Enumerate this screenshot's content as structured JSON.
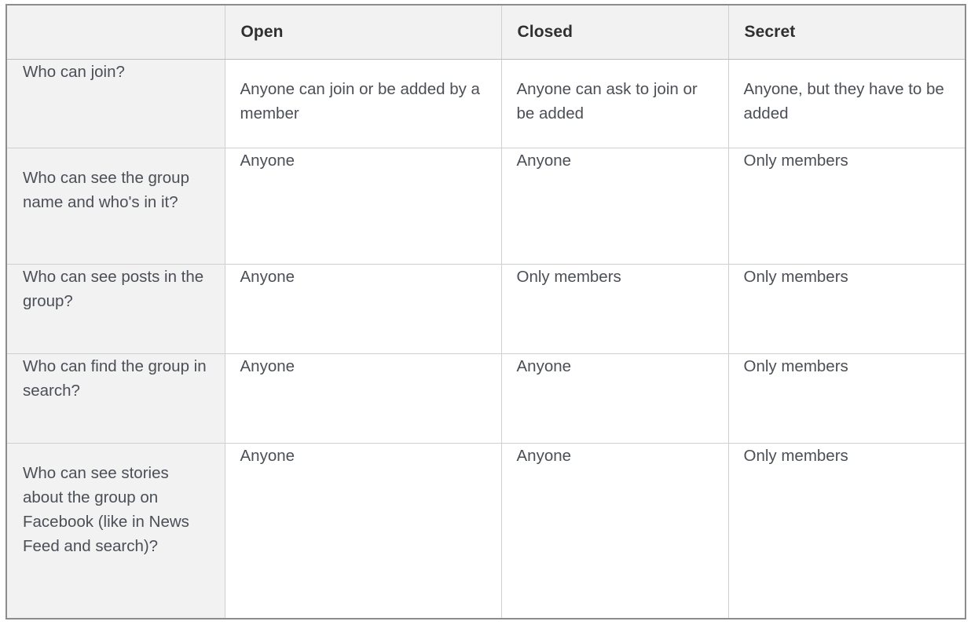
{
  "document": {
    "type": "comparison-table",
    "colors": {
      "outer_border": "#8c8c8c",
      "inner_grid": "#cfcfcf",
      "header_background": "#f2f2f2",
      "label_column_background": "#f2f2f2",
      "value_background": "#ffffff",
      "header_text": "#303030",
      "body_text": "#4b4f56",
      "page_background": "#ffffff"
    }
  },
  "table": {
    "columns": [
      {
        "key": "label",
        "label": ""
      },
      {
        "key": "open",
        "label": "Open"
      },
      {
        "key": "closed",
        "label": "Closed"
      },
      {
        "key": "secret",
        "label": "Secret"
      }
    ],
    "rows": [
      {
        "id": "who-can-join",
        "label": "Who can join?",
        "label_valign": "middle",
        "value_valign": "top",
        "open": "Anyone can join or be added by a member",
        "closed": "Anyone can ask to join or be added",
        "secret": "Anyone, but they have to be added"
      },
      {
        "id": "who-can-see-name",
        "label": "Who can see the group name and who's in it?",
        "label_valign": "top",
        "value_valign": "middle",
        "open": "Anyone",
        "closed": "Anyone",
        "secret": "Only members"
      },
      {
        "id": "who-can-see-posts",
        "label": "Who can see posts in the group?",
        "label_valign": "middle",
        "value_valign": "middle",
        "open": "Anyone",
        "closed": "Only members",
        "secret": "Only members"
      },
      {
        "id": "who-can-find-group",
        "label": "Who can find the group in search?",
        "label_valign": "middle",
        "value_valign": "middle",
        "open": "Anyone",
        "closed": "Anyone",
        "secret": "Only members"
      },
      {
        "id": "who-can-see-stories",
        "label": "Who can see stories about the group on Facebook (like in News Feed and search)?",
        "label_valign": "top",
        "value_valign": "middle",
        "open": "Anyone",
        "closed": "Anyone",
        "secret": "Only members"
      }
    ]
  }
}
